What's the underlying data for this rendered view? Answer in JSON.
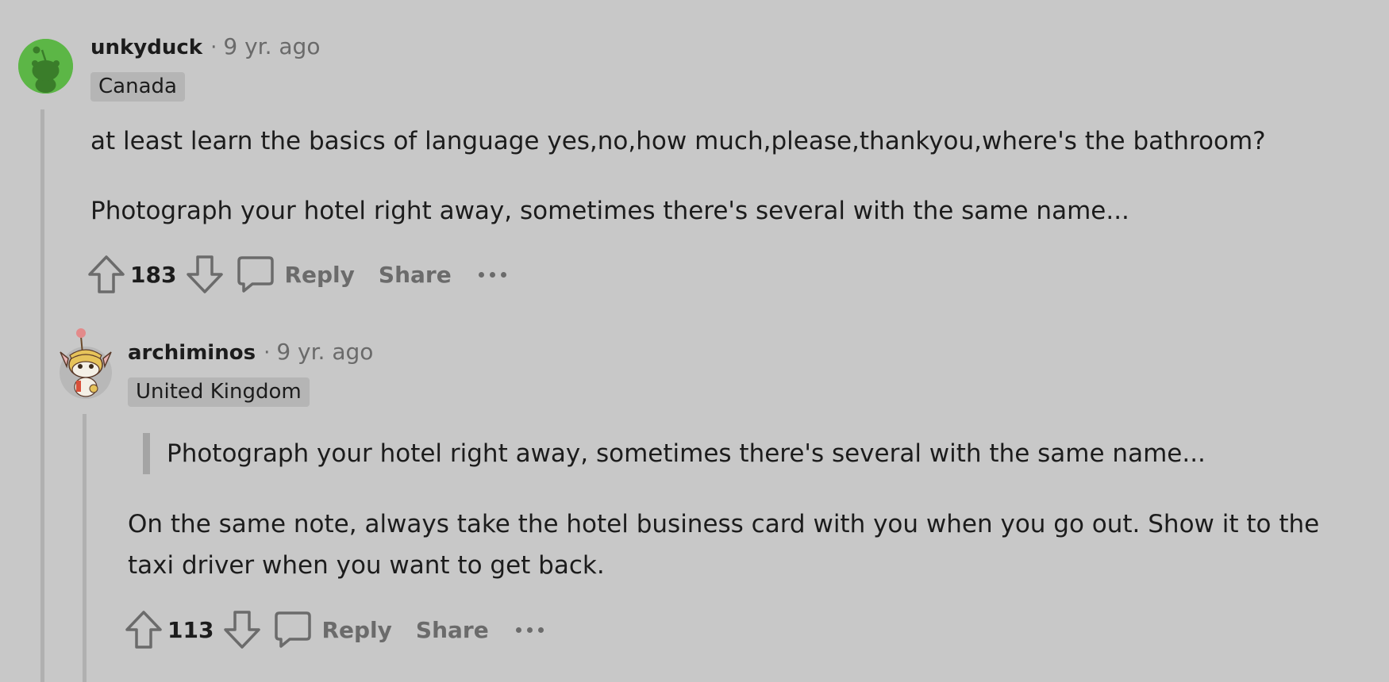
{
  "comments": [
    {
      "username": "unkyduck",
      "separator": "·",
      "time": "9 yr. ago",
      "flair": "Canada",
      "paragraphs": [
        "at least learn the basics of language yes,no,how much,please,thankyou,where's the bathroom?",
        "Photograph your hotel right away, sometimes there's several with the same name..."
      ],
      "score": "183",
      "reply_label": "Reply",
      "share_label": "Share",
      "avatar_icon": "snoo-avatar-icon",
      "avatar_color": "#5cb646"
    },
    {
      "username": "archiminos",
      "separator": "·",
      "time": "9 yr. ago",
      "flair": "United Kingdom",
      "quote": "Photograph your hotel right away, sometimes there's several with the same name...",
      "paragraphs": [
        "On the same note, always take the hotel business card with you when you go out. Show it to the taxi driver when you want to get back."
      ],
      "score": "113",
      "reply_label": "Reply",
      "share_label": "Share",
      "avatar_icon": "custom-snoo-avatar-icon"
    }
  ],
  "icons": {
    "upvote": "arrow-up-icon",
    "downvote": "arrow-down-icon",
    "comment": "speech-bubble-icon",
    "more": "ellipsis-icon"
  },
  "colors": {
    "background": "#c8c8c8",
    "thread_line": "#b0b0b0",
    "flair_bg": "#b5b5b5",
    "muted_text": "#6b6b6b"
  }
}
